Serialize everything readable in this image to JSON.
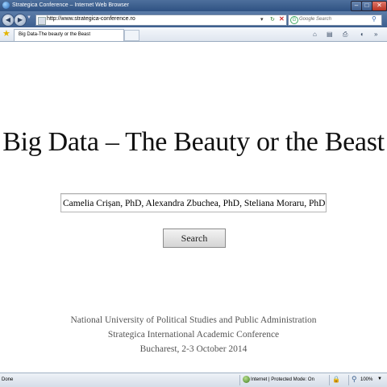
{
  "window": {
    "title": "Strategica Conference – Internet Web Browser"
  },
  "address_bar": {
    "url": "http://www.strategica-conference.ro",
    "search_placeholder": "Google Search"
  },
  "tabs": [
    {
      "label": "Big Data-The beauty or the Beast"
    }
  ],
  "page": {
    "headline": "Big Data – The Beauty or the Beast",
    "authors_value": "Camelia Crișan, PhD, Alexandra Zbuchea, PhD, Steliana Moraru, PhD Candidate",
    "search_label": "Search",
    "footer": {
      "line1": "National University of Political Studies and Public Administration",
      "line2": "Strategica International Academic Conference",
      "line3": "Bucharest, 2-3 October 2014"
    }
  },
  "status_bar": {
    "status": "Done",
    "zone": "Internet | Protected Mode: On",
    "zoom": "100%"
  },
  "colors": {
    "titlebar": "#3d5f8f",
    "footer_text": "#555555"
  }
}
